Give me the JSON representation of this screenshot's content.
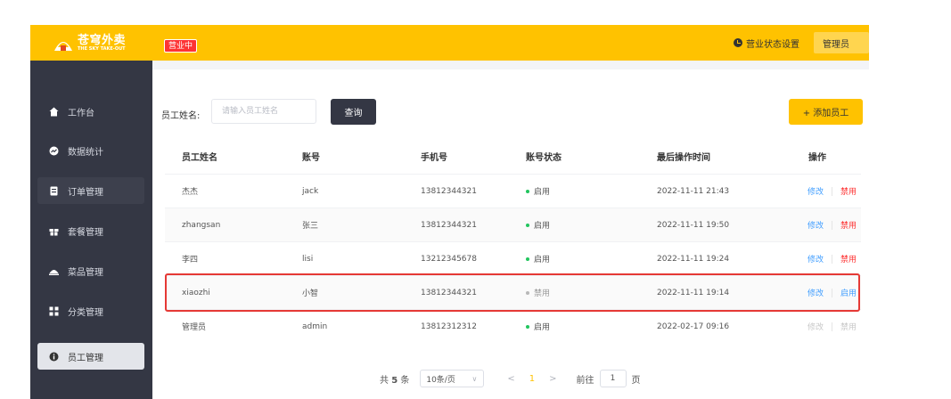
{
  "header": {
    "logo_cn": "苍穹外卖",
    "logo_en": "THE SKY TAKE-OUT",
    "status_tag": "营业中",
    "biz_setting": "营业状态设置",
    "admin": "管理员"
  },
  "sidebar": {
    "items": [
      {
        "label": "工作台",
        "icon": "home-icon"
      },
      {
        "label": "数据统计",
        "icon": "chart-icon"
      },
      {
        "label": "订单管理",
        "icon": "order-icon"
      },
      {
        "label": "套餐管理",
        "icon": "package-icon"
      },
      {
        "label": "菜品管理",
        "icon": "dish-icon"
      },
      {
        "label": "分类管理",
        "icon": "category-icon"
      },
      {
        "label": "员工管理",
        "icon": "employee-icon"
      }
    ]
  },
  "search": {
    "label": "员工姓名:",
    "placeholder": "请输入员工姓名",
    "button": "查询"
  },
  "add_button": "+ 添加员工",
  "table": {
    "headers": [
      "员工姓名",
      "账号",
      "手机号",
      "账号状态",
      "最后操作时间",
      "操作"
    ],
    "rows": [
      {
        "name": "杰杰",
        "account": "jack",
        "phone": "13812344321",
        "status": "启用",
        "time": "2022-11-11 21:43",
        "edit": "修改",
        "toggle": "禁用"
      },
      {
        "name": "zhangsan",
        "account": "张三",
        "phone": "13812344321",
        "status": "启用",
        "time": "2022-11-11 19:50",
        "edit": "修改",
        "toggle": "禁用"
      },
      {
        "name": "李四",
        "account": "lisi",
        "phone": "13212345678",
        "status": "启用",
        "time": "2022-11-11 19:24",
        "edit": "修改",
        "toggle": "禁用"
      },
      {
        "name": "xiaozhi",
        "account": "小智",
        "phone": "13812344321",
        "status": "禁用",
        "time": "2022-11-11 19:14",
        "edit": "修改",
        "toggle": "启用"
      },
      {
        "name": "管理员",
        "account": "admin",
        "phone": "13812312312",
        "status": "启用",
        "time": "2022-02-17 09:16",
        "edit": "修改",
        "toggle": "禁用"
      }
    ]
  },
  "pager": {
    "total_prefix": "共",
    "total": "5",
    "total_suffix": "条",
    "page_size": "10条/页",
    "current": "1",
    "goto_label": "前往",
    "goto_value": "1",
    "page_unit": "页"
  },
  "colors": {
    "brand": "#ffc200",
    "sidebar": "#343744",
    "enabled_dot": "#22c55e",
    "disabled_dot": "#b8b8b8",
    "link_blue": "#419eff",
    "link_red": "#fd3333",
    "highlight": "#e53935"
  }
}
